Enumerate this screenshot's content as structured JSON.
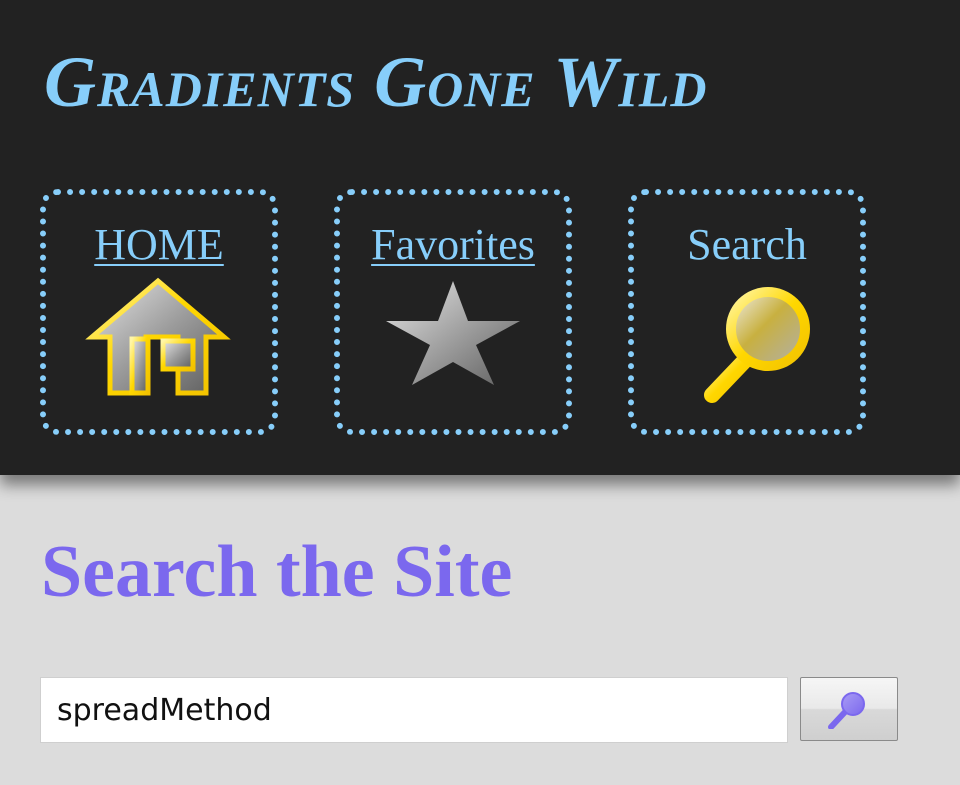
{
  "header": {
    "site_title": "Gradients Gone Wild"
  },
  "nav": {
    "items": [
      {
        "label": "HOME",
        "icon": "home-icon",
        "link": true
      },
      {
        "label": "Favorites",
        "icon": "star-icon",
        "link": true
      },
      {
        "label": "Search",
        "icon": "magnifier-icon",
        "link": false
      }
    ]
  },
  "main": {
    "title": "Search the Site",
    "search": {
      "value": "spreadMethod",
      "button_icon": "search-icon"
    }
  },
  "colors": {
    "header_bg": "#222222",
    "page_bg": "#dcdcdc",
    "accent": "#87cefa",
    "title_purple": "#7b68ee",
    "gold": "#ffd700",
    "gray": "#9a9a9a"
  }
}
